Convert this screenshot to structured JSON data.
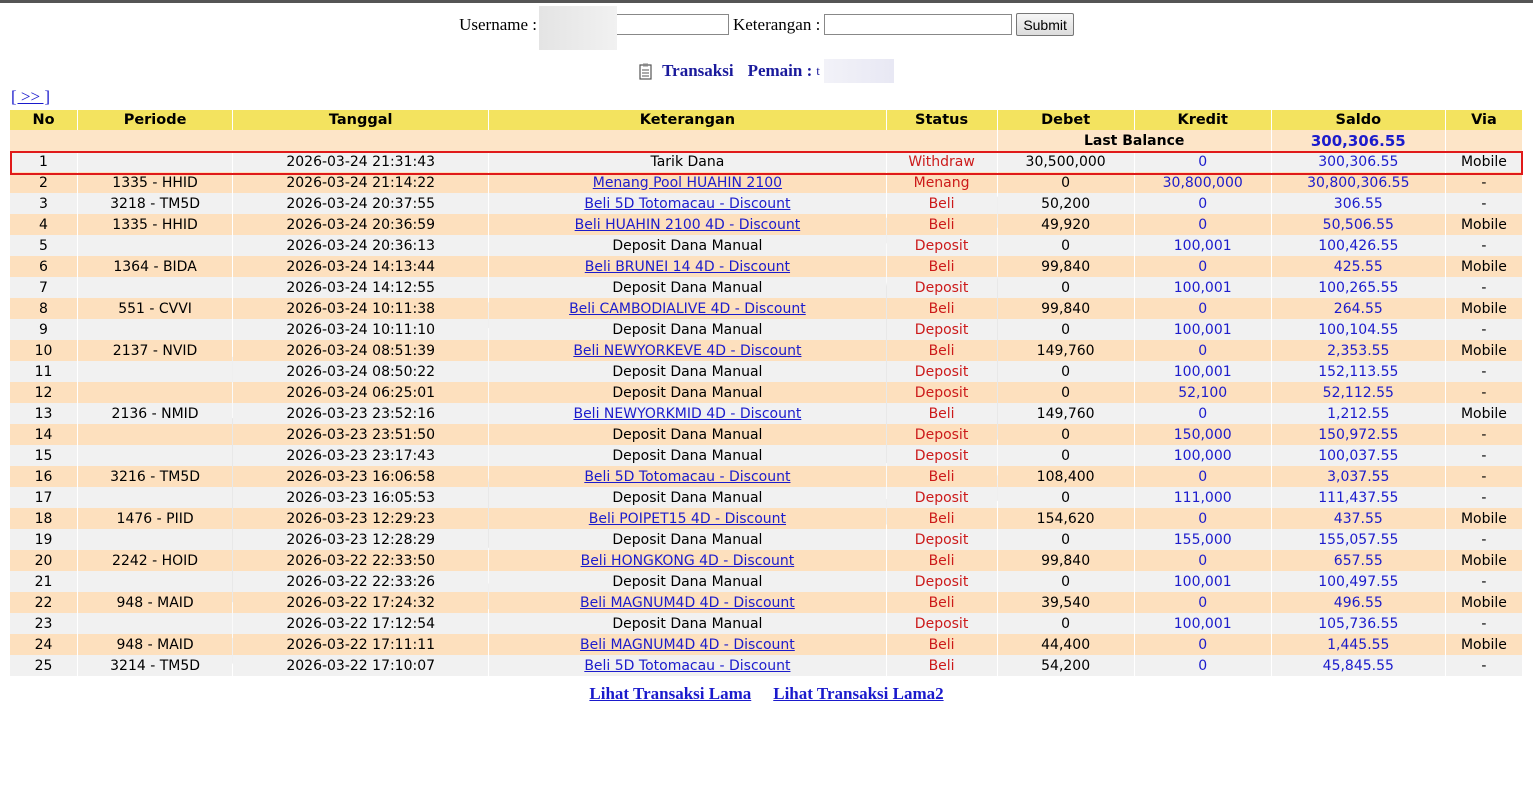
{
  "search": {
    "username_label": "Username :",
    "username_value": "",
    "keterangan_label": "Keterangan :",
    "keterangan_value": "",
    "submit_label": "Submit"
  },
  "heading": {
    "title": "Transaksi",
    "pemain_label": "Pemain :",
    "pemain_value": "t"
  },
  "nav": {
    "next_label": "[ >> ]"
  },
  "table": {
    "headers": [
      "No",
      "Periode",
      "Tanggal",
      "Keterangan",
      "Status",
      "Debet",
      "Kredit",
      "Saldo",
      "Via"
    ],
    "last_balance_label": "Last Balance",
    "last_balance_value": "300,306.55",
    "rows": [
      {
        "no": "1",
        "periode": "",
        "tanggal": "2026-03-24 21:31:43",
        "keterangan": "Tarik Dana",
        "status": "Withdraw",
        "debet": "30,500,000",
        "kredit": "0",
        "saldo": "300,306.55",
        "via": "Mobile"
      },
      {
        "no": "2",
        "periode": "1335 - HHID",
        "tanggal": "2026-03-24 21:14:22",
        "keterangan": "Menang Pool HUAHIN 2100",
        "status": "Menang",
        "debet": "0",
        "kredit": "30,800,000",
        "saldo": "30,800,306.55",
        "via": "-"
      },
      {
        "no": "3",
        "periode": "3218 - TM5D",
        "tanggal": "2026-03-24 20:37:55",
        "keterangan": "Beli 5D Totomacau - Discount",
        "status": "Beli",
        "debet": "50,200",
        "kredit": "0",
        "saldo": "306.55",
        "via": "-"
      },
      {
        "no": "4",
        "periode": "1335 - HHID",
        "tanggal": "2026-03-24 20:36:59",
        "keterangan": "Beli HUAHIN 2100 4D - Discount",
        "status": "Beli",
        "debet": "49,920",
        "kredit": "0",
        "saldo": "50,506.55",
        "via": "Mobile"
      },
      {
        "no": "5",
        "periode": "",
        "tanggal": "2026-03-24 20:36:13",
        "keterangan": "Deposit Dana Manual",
        "status": "Deposit",
        "debet": "0",
        "kredit": "100,001",
        "saldo": "100,426.55",
        "via": "-"
      },
      {
        "no": "6",
        "periode": "1364 - BIDA",
        "tanggal": "2026-03-24 14:13:44",
        "keterangan": "Beli BRUNEI 14 4D - Discount",
        "status": "Beli",
        "debet": "99,840",
        "kredit": "0",
        "saldo": "425.55",
        "via": "Mobile"
      },
      {
        "no": "7",
        "periode": "",
        "tanggal": "2026-03-24 14:12:55",
        "keterangan": "Deposit Dana Manual",
        "status": "Deposit",
        "debet": "0",
        "kredit": "100,001",
        "saldo": "100,265.55",
        "via": "-"
      },
      {
        "no": "8",
        "periode": "551 - CVVI",
        "tanggal": "2026-03-24 10:11:38",
        "keterangan": "Beli CAMBODIALIVE 4D - Discount",
        "status": "Beli",
        "debet": "99,840",
        "kredit": "0",
        "saldo": "264.55",
        "via": "Mobile"
      },
      {
        "no": "9",
        "periode": "",
        "tanggal": "2026-03-24 10:11:10",
        "keterangan": "Deposit Dana Manual",
        "status": "Deposit",
        "debet": "0",
        "kredit": "100,001",
        "saldo": "100,104.55",
        "via": "-"
      },
      {
        "no": "10",
        "periode": "2137 - NVID",
        "tanggal": "2026-03-24 08:51:39",
        "keterangan": "Beli NEWYORKEVE 4D - Discount",
        "status": "Beli",
        "debet": "149,760",
        "kredit": "0",
        "saldo": "2,353.55",
        "via": "Mobile"
      },
      {
        "no": "11",
        "periode": "",
        "tanggal": "2026-03-24 08:50:22",
        "keterangan": "Deposit Dana Manual",
        "status": "Deposit",
        "debet": "0",
        "kredit": "100,001",
        "saldo": "152,113.55",
        "via": "-"
      },
      {
        "no": "12",
        "periode": "",
        "tanggal": "2026-03-24 06:25:01",
        "keterangan": "Deposit Dana Manual",
        "status": "Deposit",
        "debet": "0",
        "kredit": "52,100",
        "saldo": "52,112.55",
        "via": "-"
      },
      {
        "no": "13",
        "periode": "2136 - NMID",
        "tanggal": "2026-03-23 23:52:16",
        "keterangan": "Beli NEWYORKMID 4D - Discount",
        "status": "Beli",
        "debet": "149,760",
        "kredit": "0",
        "saldo": "1,212.55",
        "via": "Mobile"
      },
      {
        "no": "14",
        "periode": "",
        "tanggal": "2026-03-23 23:51:50",
        "keterangan": "Deposit Dana Manual",
        "status": "Deposit",
        "debet": "0",
        "kredit": "150,000",
        "saldo": "150,972.55",
        "via": "-"
      },
      {
        "no": "15",
        "periode": "",
        "tanggal": "2026-03-23 23:17:43",
        "keterangan": "Deposit Dana Manual",
        "status": "Deposit",
        "debet": "0",
        "kredit": "100,000",
        "saldo": "100,037.55",
        "via": "-"
      },
      {
        "no": "16",
        "periode": "3216 - TM5D",
        "tanggal": "2026-03-23 16:06:58",
        "keterangan": "Beli 5D Totomacau - Discount",
        "status": "Beli",
        "debet": "108,400",
        "kredit": "0",
        "saldo": "3,037.55",
        "via": "-"
      },
      {
        "no": "17",
        "periode": "",
        "tanggal": "2026-03-23 16:05:53",
        "keterangan": "Deposit Dana Manual",
        "status": "Deposit",
        "debet": "0",
        "kredit": "111,000",
        "saldo": "111,437.55",
        "via": "-"
      },
      {
        "no": "18",
        "periode": "1476 - PIID",
        "tanggal": "2026-03-23 12:29:23",
        "keterangan": "Beli POIPET15 4D - Discount",
        "status": "Beli",
        "debet": "154,620",
        "kredit": "0",
        "saldo": "437.55",
        "via": "Mobile"
      },
      {
        "no": "19",
        "periode": "",
        "tanggal": "2026-03-23 12:28:29",
        "keterangan": "Deposit Dana Manual",
        "status": "Deposit",
        "debet": "0",
        "kredit": "155,000",
        "saldo": "155,057.55",
        "via": "-"
      },
      {
        "no": "20",
        "periode": "2242 - HOID",
        "tanggal": "2026-03-22 22:33:50",
        "keterangan": "Beli HONGKONG 4D - Discount",
        "status": "Beli",
        "debet": "99,840",
        "kredit": "0",
        "saldo": "657.55",
        "via": "Mobile"
      },
      {
        "no": "21",
        "periode": "",
        "tanggal": "2026-03-22 22:33:26",
        "keterangan": "Deposit Dana Manual",
        "status": "Deposit",
        "debet": "0",
        "kredit": "100,001",
        "saldo": "100,497.55",
        "via": "-"
      },
      {
        "no": "22",
        "periode": "948 - MAID",
        "tanggal": "2026-03-22 17:24:32",
        "keterangan": "Beli MAGNUM4D 4D - Discount",
        "status": "Beli",
        "debet": "39,540",
        "kredit": "0",
        "saldo": "496.55",
        "via": "Mobile"
      },
      {
        "no": "23",
        "periode": "",
        "tanggal": "2026-03-22 17:12:54",
        "keterangan": "Deposit Dana Manual",
        "status": "Deposit",
        "debet": "0",
        "kredit": "100,001",
        "saldo": "105,736.55",
        "via": "-"
      },
      {
        "no": "24",
        "periode": "948 - MAID",
        "tanggal": "2026-03-22 17:11:11",
        "keterangan": "Beli MAGNUM4D 4D - Discount",
        "status": "Beli",
        "debet": "44,400",
        "kredit": "0",
        "saldo": "1,445.55",
        "via": "Mobile"
      },
      {
        "no": "25",
        "periode": "3214 - TM5D",
        "tanggal": "2026-03-22 17:10:07",
        "keterangan": "Beli 5D Totomacau - Discount",
        "status": "Beli",
        "debet": "54,200",
        "kredit": "0",
        "saldo": "45,845.55",
        "via": "-"
      }
    ]
  },
  "footer": {
    "link1": "Lihat Transaksi Lama",
    "link2": "Lihat Transaksi Lama2"
  },
  "colors": {
    "header_bg": "#f3e35f",
    "row_odd": "#f1f1f1",
    "row_even": "#fde0be",
    "status_red": "#cc1a1a",
    "link_blue": "#1c1ccc",
    "highlight_border": "#e01a1a"
  }
}
